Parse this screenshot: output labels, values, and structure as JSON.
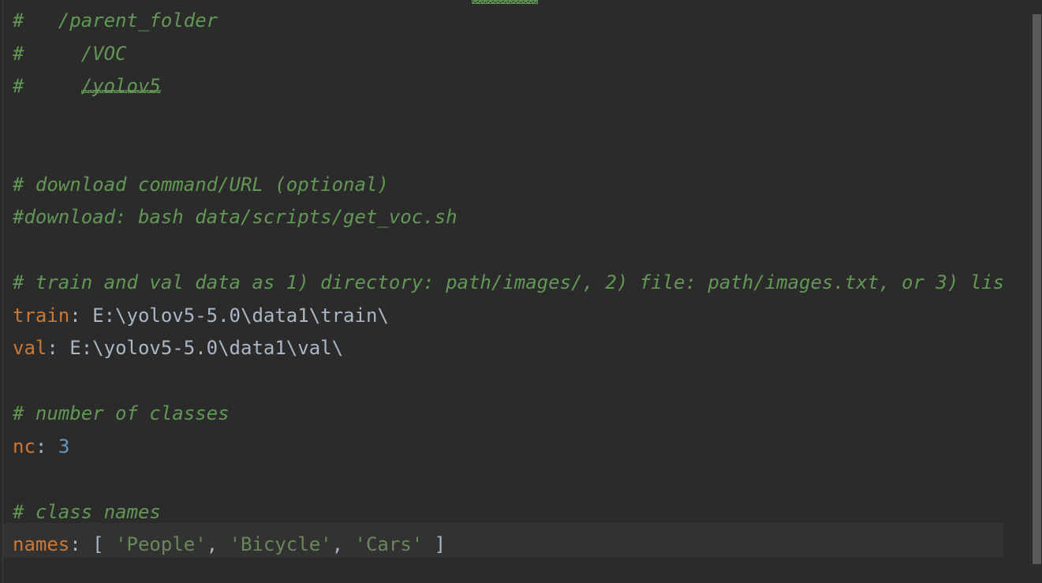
{
  "editor": {
    "app": "code-editor",
    "theme": "darcula",
    "language": "yaml",
    "background_color": "#2b2b2b",
    "current_line_highlight_color": "#323232",
    "colors": {
      "comment": "#629755",
      "key": "#cc7832",
      "value_text": "#a9b7c6",
      "number": "#6897bb",
      "string": "#6a8759",
      "bracket": "#a9b7c6",
      "scrollbar_thumb": "#5a5a5a",
      "gutter_border": "#3c3f41"
    },
    "lines": [
      {
        "id": "line-parent-folder",
        "kind": "comment",
        "text": "#   /parent_folder"
      },
      {
        "id": "line-voc",
        "kind": "comment",
        "text": "#     /VOC"
      },
      {
        "id": "line-yolov5",
        "kind": "comment",
        "text": "#     /yolov5",
        "prefix": "#     ",
        "spellchecked": "/yolov5"
      },
      {
        "id": "line-blank-1",
        "kind": "blank",
        "text": ""
      },
      {
        "id": "line-blank-2",
        "kind": "blank",
        "text": ""
      },
      {
        "id": "line-download-comment",
        "kind": "comment",
        "text": "# download command/URL (optional)"
      },
      {
        "id": "line-download-disabled",
        "kind": "comment",
        "text": "#download: bash data/scripts/get_voc.sh"
      },
      {
        "id": "line-blank-3",
        "kind": "blank",
        "text": ""
      },
      {
        "id": "line-traindata-comment",
        "kind": "comment",
        "text": "# train and val data as 1) directory: path/images/, 2) file: path/images.txt, or 3) lis"
      },
      {
        "id": "line-train",
        "kind": "keyvalue",
        "key": "train",
        "separator": ": ",
        "value": "E:\\yolov5-5.0\\data1\\train\\"
      },
      {
        "id": "line-val",
        "kind": "keyvalue",
        "key": "val",
        "separator": ": ",
        "value": "E:\\yolov5-5.0\\data1\\val\\"
      },
      {
        "id": "line-blank-4",
        "kind": "blank",
        "text": ""
      },
      {
        "id": "line-nc-comment",
        "kind": "comment",
        "text": "# number of classes"
      },
      {
        "id": "line-nc",
        "kind": "keynumber",
        "key": "nc",
        "separator": ": ",
        "value": "3"
      },
      {
        "id": "line-blank-5",
        "kind": "blank",
        "text": ""
      },
      {
        "id": "line-names-comment",
        "kind": "comment",
        "text": "# class names"
      },
      {
        "id": "line-names",
        "kind": "keylist",
        "key": "names",
        "separator": ": ",
        "open_bracket": "[ ",
        "items": [
          "'People'",
          "'Bicycle'",
          "'Cars'"
        ],
        "item_separator": ", ",
        "close_bracket": " ]",
        "is_current_line": true
      }
    ],
    "scrollbar": {
      "name": "vertical-scrollbar",
      "orientation": "vertical"
    }
  }
}
